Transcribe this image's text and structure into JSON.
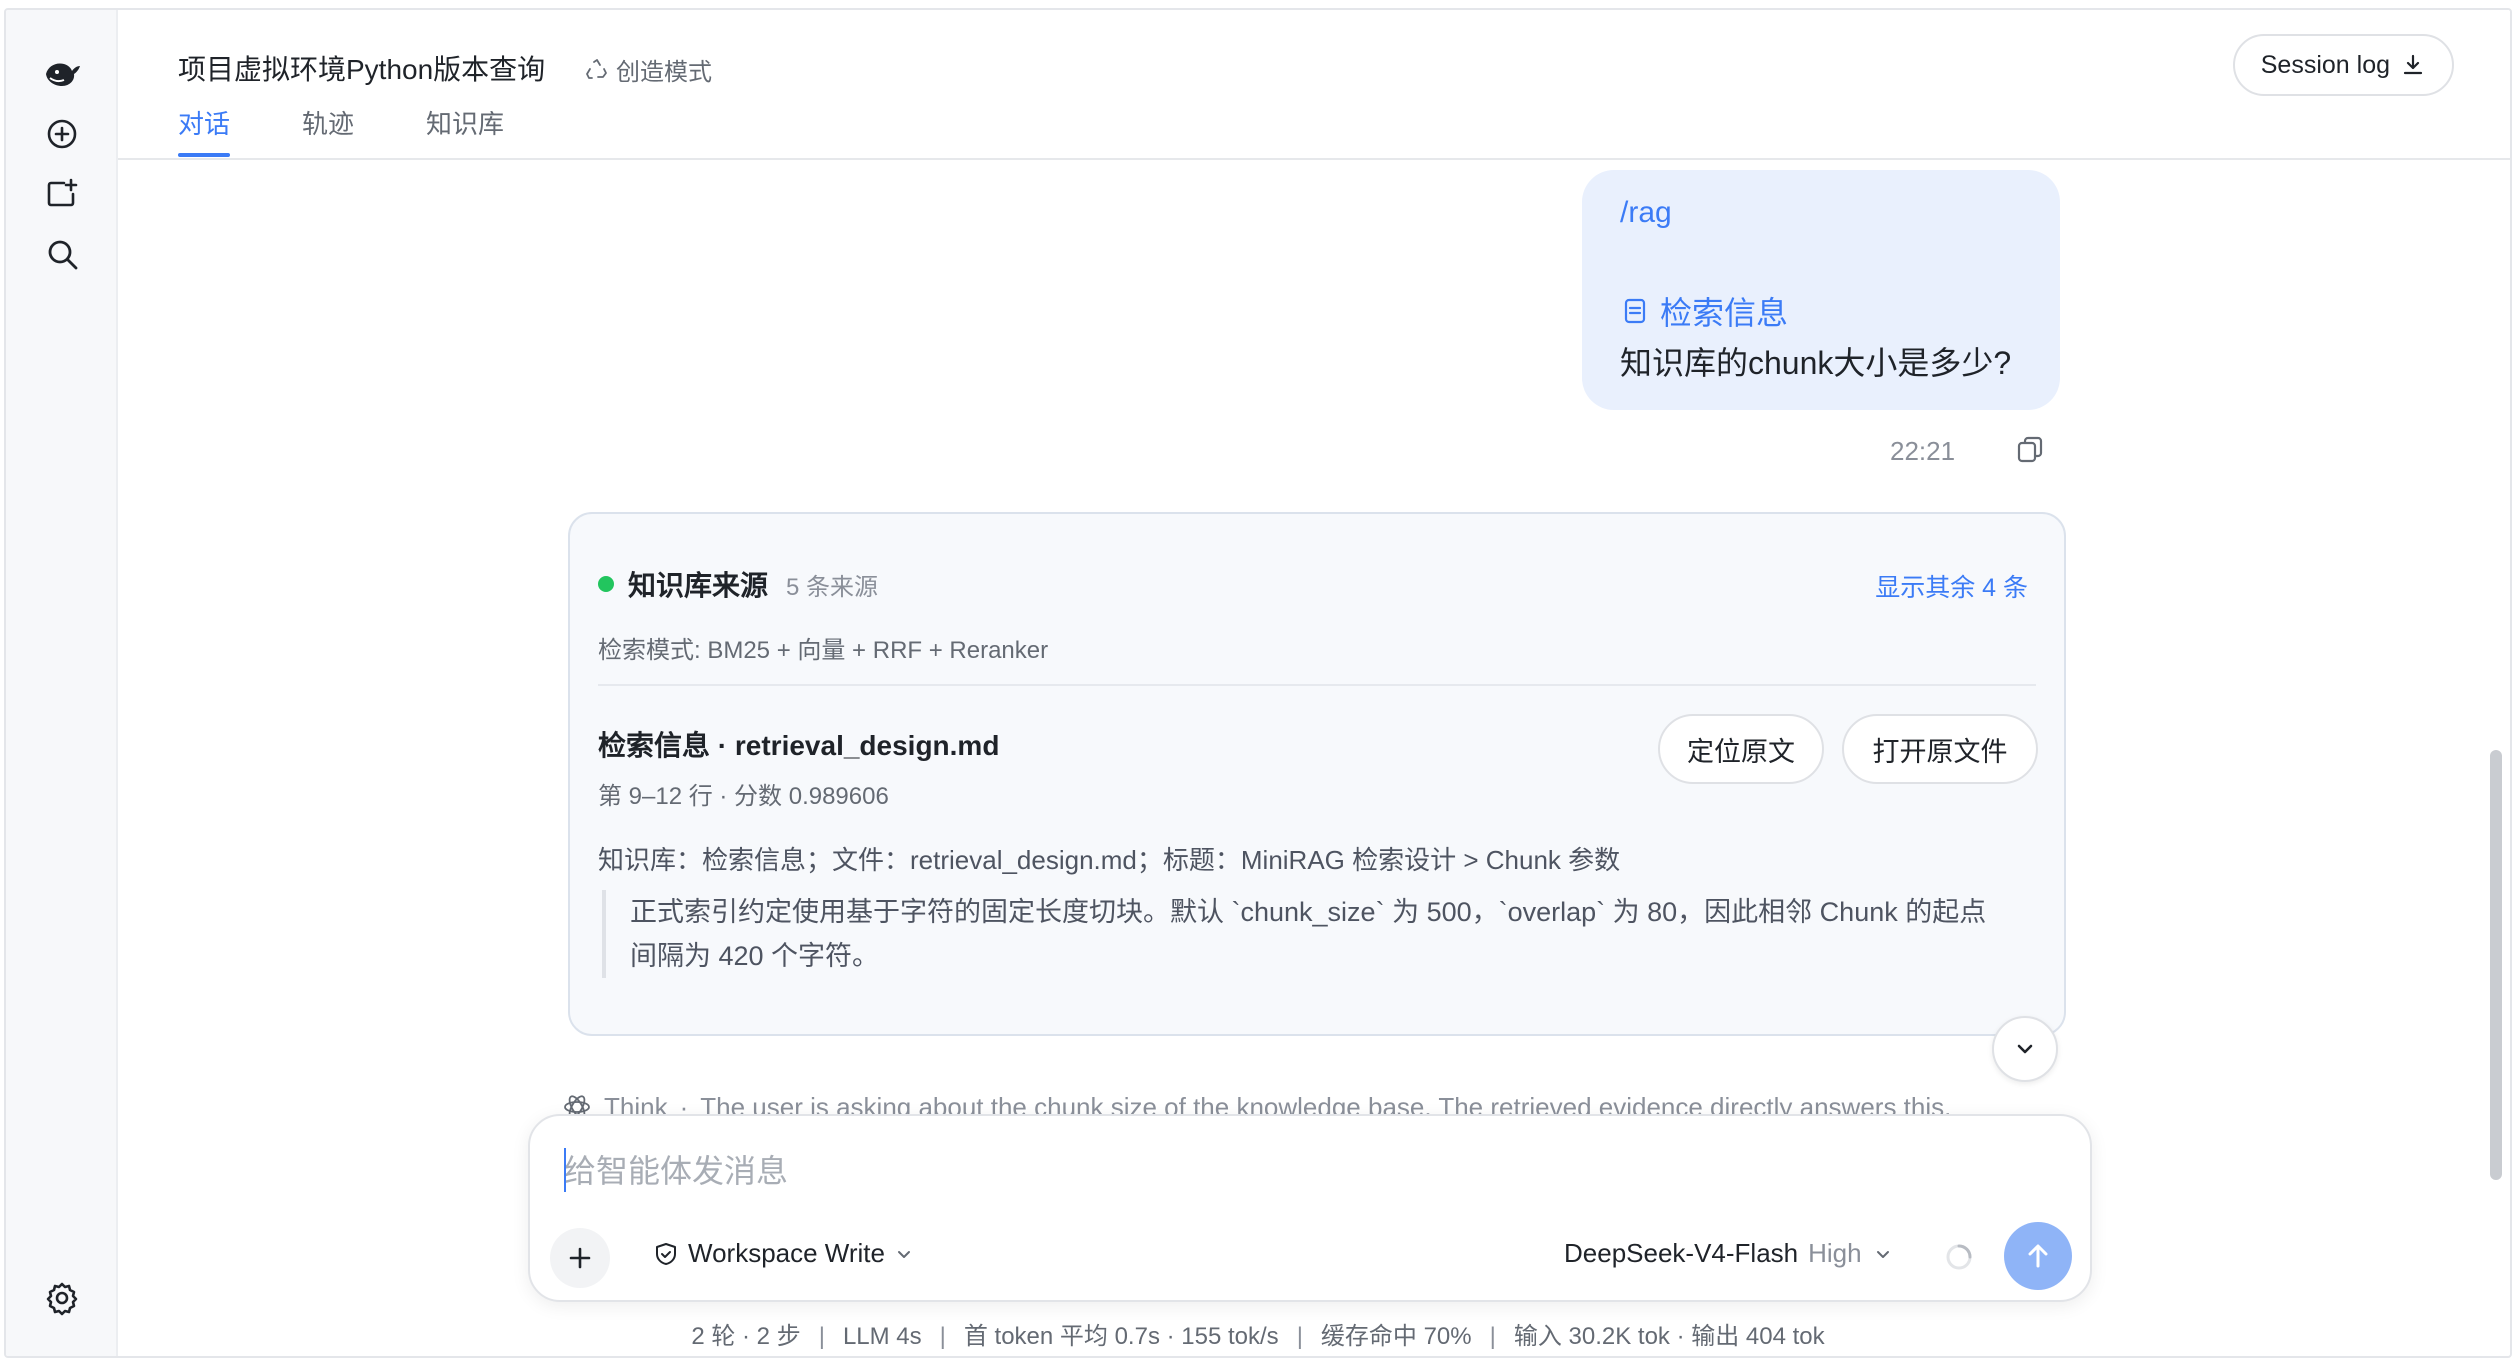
{
  "sidebar": {
    "icons": [
      "whale-logo-icon",
      "new-chat-icon",
      "new-folder-icon",
      "search-icon",
      "settings-icon"
    ]
  },
  "header": {
    "title": "项目虚拟环境Python版本查询",
    "mode": "创造模式",
    "tabs": [
      {
        "label": "对话",
        "active": true
      },
      {
        "label": "轨迹",
        "active": false
      },
      {
        "label": "知识库",
        "active": false
      }
    ],
    "session_log": "Session log"
  },
  "user_message": {
    "command": "/rag",
    "kb_ref": "检索信息",
    "question": "知识库的chunk大小是多少?",
    "time": "22:21"
  },
  "sources": {
    "title": "知识库来源",
    "count": "5 条来源",
    "show_more": "显示其余 4 条",
    "search_mode": "检索模式: BM25 + 向量 + RRF + Reranker",
    "hit": {
      "title": "检索信息 · retrieval_design.md",
      "meta": "第 9–12 行 · 分数 0.989606",
      "locate_btn": "定位原文",
      "open_btn": "打开原文件",
      "path": "知识库：检索信息；文件：retrieval_design.md；标题：MiniRAG 检索设计 > Chunk 参数",
      "quote_line1": "正式索引约定使用基于字符的固定长度切块。默认 `chunk_size` 为 500，`overlap` 为 80，因此相邻 Chunk 的起点",
      "quote_line2": "间隔为 420 个字符。"
    }
  },
  "think": {
    "label": "Think",
    "separator": "·",
    "text": "The user is asking about the chunk size of the knowledge base. The retrieved evidence directly answers this."
  },
  "composer": {
    "placeholder": "给智能体发消息",
    "value": "",
    "workspace": "Workspace Write",
    "model": "DeepSeek-V4-Flash",
    "level": "High"
  },
  "stats": {
    "turns": "2 轮 · 2 步",
    "llm": "LLM 4s",
    "first_token": "首 token 平均 0.7s · 155 tok/s",
    "cache": "缓存命中 70%",
    "io": "输入 30.2K tok · 输出 404 tok",
    "separator": "|"
  },
  "colors": {
    "accent": "#3b7bf6",
    "user_bubble": "#e9f0fd",
    "status_dot": "#22c55e",
    "send_button": "#8fb4f7"
  }
}
